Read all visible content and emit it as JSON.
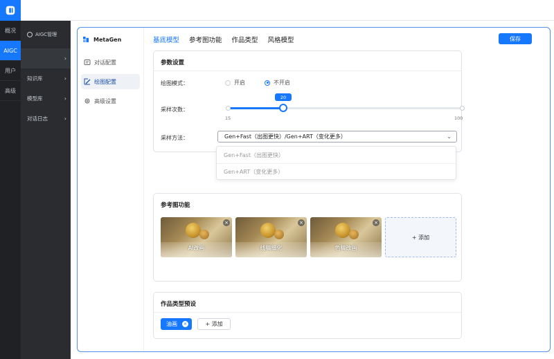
{
  "rail": {
    "items": [
      "概况",
      "AIGC",
      "用户",
      "高级"
    ]
  },
  "nav": {
    "header": "AIGC管理",
    "items": [
      {
        "label": ""
      },
      {
        "label": "知识库"
      },
      {
        "label": "模型库"
      },
      {
        "label": "对话日志"
      }
    ]
  },
  "sub": {
    "brand": "MetaGen",
    "items": [
      "对话配置",
      "绘图配置",
      "高级设置"
    ]
  },
  "tabs": [
    "基底模型",
    "参考图功能",
    "作品类型",
    "风格模型"
  ],
  "save_label": "保存",
  "params": {
    "title": "参数设置",
    "mode_label": "绘图模式：",
    "mode_options": [
      "开启",
      "不开启"
    ],
    "mode_selected": "不开启",
    "steps_label": "采样次数：",
    "steps_value": "20",
    "steps_min": "15",
    "steps_max": "100",
    "method_label": "采样方法：",
    "method_value": "Gen+Fast（出图更快）/Gen+ART（变化更多）",
    "dropdown_options": [
      "Gen+Fast（出图更快）",
      "Gen+ART（变化更多）"
    ]
  },
  "ref": {
    "title": "参考图功能",
    "images": [
      "AI改画",
      "线稿细化",
      "色稿改画"
    ],
    "add_label": "+ 添加"
  },
  "types": {
    "title": "作品类型预设",
    "tags": [
      "油画"
    ],
    "add_label": "+ 添加"
  },
  "colors": {
    "accent": "#1677ff",
    "rail_bg": "#1f2124",
    "nav_bg": "#2a2c2f"
  }
}
